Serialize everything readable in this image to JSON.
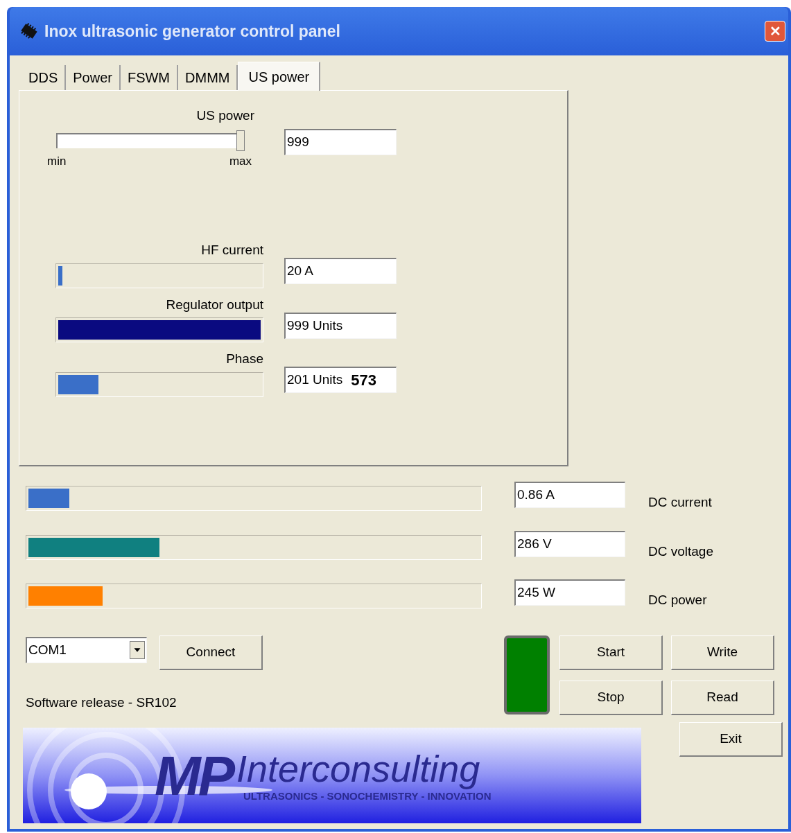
{
  "window": {
    "title": "Inox ultrasonic generator control panel",
    "close_label": "✕"
  },
  "tabs": [
    {
      "label": "DDS",
      "selected": false
    },
    {
      "label": "Power",
      "selected": false
    },
    {
      "label": "FSWM",
      "selected": false
    },
    {
      "label": "DMMM",
      "selected": false
    },
    {
      "label": "US power",
      "selected": true
    }
  ],
  "us_power": {
    "label": "US power",
    "level": 1,
    "value": "999",
    "min_label": "min",
    "max_label": "max"
  },
  "meters": [
    {
      "label": "HF current",
      "level": 0.02,
      "color": "#3a6fc8",
      "value": "20 A"
    },
    {
      "label": "Regulator output",
      "level": 1,
      "color": "#0a0a80",
      "value": "999 Units"
    },
    {
      "label": "Phase",
      "level": 0.2,
      "color": "#3a6fc8",
      "value": "201 Units",
      "extra": "573"
    }
  ],
  "dc_meters": [
    {
      "label": "DC current",
      "level": 0.09,
      "color": "#3a6fc8",
      "value": "0.86 A"
    },
    {
      "label": "DC voltage",
      "level": 0.29,
      "color": "#108080",
      "value": "286 V"
    },
    {
      "label": "DC power",
      "level": 0.165,
      "color": "#ff8000",
      "value": "245 W"
    }
  ],
  "port": {
    "value": "COM1"
  },
  "connect_button": "Connect",
  "software_release": "Software release - SR102",
  "status_led": {
    "on": true
  },
  "buttons": {
    "start": "Start",
    "write": "Write",
    "stop": "Stop",
    "read": "Read",
    "exit": "Exit"
  },
  "logo": {
    "mark": "MP",
    "name": "Interconsulting",
    "tagline": "ULTRASONICS - SONOCHEMISTRY - INNOVATION"
  }
}
